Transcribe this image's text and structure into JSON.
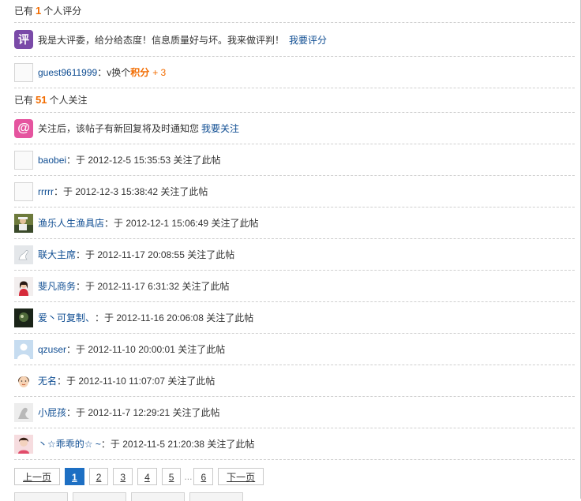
{
  "rating": {
    "count_prefix": "已有",
    "count": "1",
    "count_suffix": "个人评分",
    "prompt": "我是大评委，给分给态度！信息质量好与坏。我来做评判！",
    "prompt_link": "我要评分",
    "badge_icon": "评",
    "rater_user": "guest9611999",
    "rater_text": "：v换个",
    "points_label": "积分",
    "points_value": "+ 3"
  },
  "follow": {
    "count_prefix": "已有",
    "count": "51",
    "count_suffix": "个人关注",
    "prompt": "关注后，该帖子有新回复将及时通知您",
    "prompt_link": "我要关注",
    "badge_icon": "@",
    "items": [
      {
        "user": "baobei",
        "time": "：于 2012-12-5 15:35:53 关注了此帖",
        "avatar": "blank"
      },
      {
        "user": "rrrrr",
        "time": "：于 2012-12-3 15:38:42 关注了此帖",
        "avatar": "blank"
      },
      {
        "user": "渔乐人生渔具店",
        "time": "：于 2012-12-1 15:06:49 关注了此帖",
        "avatar": "photo-fisher"
      },
      {
        "user": "联大主席",
        "time": "：于 2012-11-17 20:08:55 关注了此帖",
        "avatar": "photo-swan"
      },
      {
        "user": "斐凡商务",
        "time": "：于 2012-11-17 6:31:32 关注了此帖",
        "avatar": "photo-woman"
      },
      {
        "user": "爱丶可复制、",
        "time": "：于 2012-11-16 20:06:08 关注了此帖",
        "avatar": "photo-dark"
      },
      {
        "user": "qzuser",
        "time": "：于 2012-11-10 20:00:01 关注了此帖",
        "avatar": "default-user"
      },
      {
        "user": "无名",
        "time": "：于 2012-11-10 11:07:07 关注了此帖",
        "avatar": "cartoon-face"
      },
      {
        "user": "小屁孩",
        "time": "：于 2012-11-7 12:29:21 关注了此帖",
        "avatar": "photo-sketch"
      },
      {
        "user": "丶☆乖乖的☆ ~",
        "time": "：于 2012-11-5 21:20:38 关注了此帖",
        "avatar": "photo-girl"
      }
    ]
  },
  "pager": {
    "prev": "上一页",
    "pages": [
      "1",
      "2",
      "3",
      "4",
      "5"
    ],
    "ellipsis": "...",
    "last": "6",
    "next": "下一页",
    "current": "1"
  }
}
